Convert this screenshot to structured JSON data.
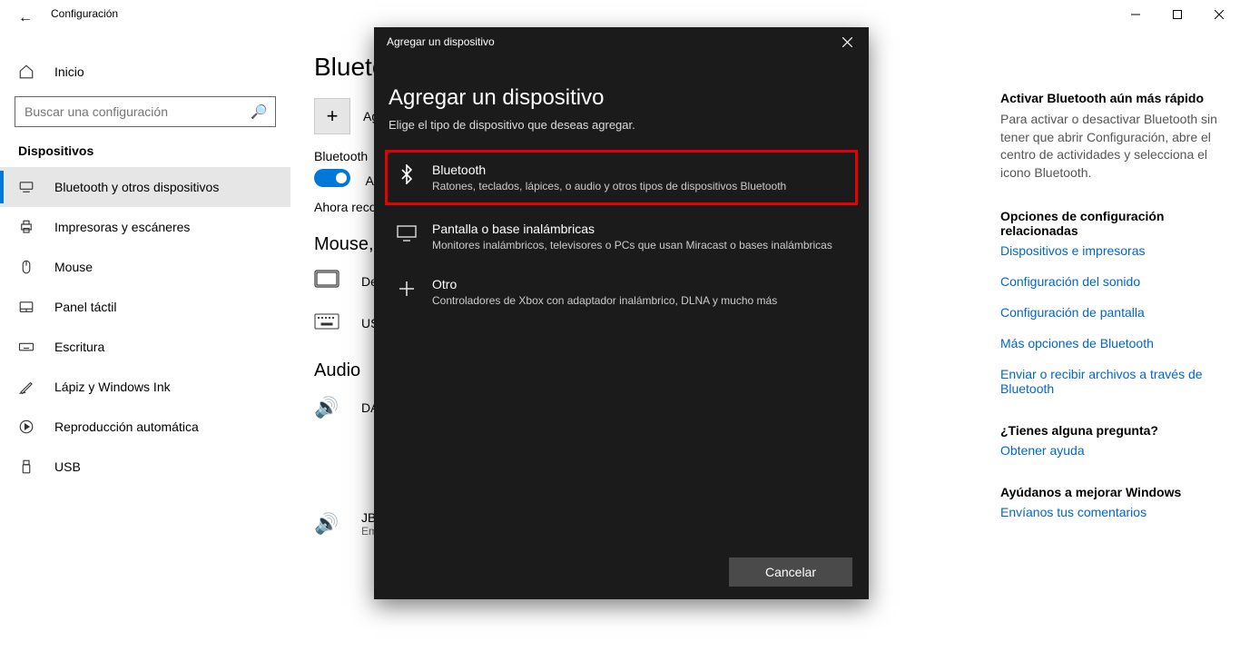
{
  "app_title": "Configuración",
  "titlebar": {
    "min": "—",
    "max": "❐",
    "close": "✕"
  },
  "back_icon": "←",
  "sidebar": {
    "home_label": "Inicio",
    "search_placeholder": "Buscar una configuración",
    "group_label": "Dispositivos",
    "items": [
      {
        "icon": "bt",
        "label": "Bluetooth y otros dispositivos",
        "selected": true
      },
      {
        "icon": "printer",
        "label": "Impresoras y escáneres"
      },
      {
        "icon": "mouse",
        "label": "Mouse"
      },
      {
        "icon": "touchpad",
        "label": "Panel táctil"
      },
      {
        "icon": "pen",
        "label": "Escritura"
      },
      {
        "icon": "ink",
        "label": "Lápiz y Windows Ink"
      },
      {
        "icon": "autoplay",
        "label": "Reproducción automática"
      },
      {
        "icon": "usb",
        "label": "USB"
      }
    ]
  },
  "main": {
    "page_title": "Bluetooth y otros dispositivos",
    "add_label": "Agregar Bluetooth u otro dispositivo",
    "bt_label": "Bluetooth",
    "toggle_state": "Activado",
    "discover_prefix": "Ahora reconocible como",
    "section_mouse": "Mouse, teclado y lápiz",
    "dev_dell": "De",
    "dev_usb": "USB",
    "section_audio": "Audio",
    "dev_da": "DA",
    "dev_jbl_name": "JBL Xtreme",
    "dev_jbl_status": "Emparejado"
  },
  "right": {
    "fast_h": "Activar Bluetooth aún más rápido",
    "fast_p": "Para activar o desactivar Bluetooth sin tener que abrir Configuración, abre el centro de actividades y selecciona el icono Bluetooth.",
    "related_h": "Opciones de configuración relacionadas",
    "links": [
      "Dispositivos e impresoras",
      "Configuración del sonido",
      "Configuración de pantalla",
      "Más opciones de Bluetooth",
      "Enviar o recibir archivos a través de Bluetooth"
    ],
    "question_h": "¿Tienes alguna pregunta?",
    "help_link": "Obtener ayuda",
    "improve_h": "Ayúdanos a mejorar Windows",
    "feedback_link": "Envíanos tus comentarios"
  },
  "modal": {
    "header": "Agregar un dispositivo",
    "title": "Agregar un dispositivo",
    "subtitle": "Elige el tipo de dispositivo que deseas agregar.",
    "options": [
      {
        "title": "Bluetooth",
        "desc": "Ratones, teclados, lápices, o audio y otros tipos de dispositivos Bluetooth",
        "highlight": true
      },
      {
        "title": "Pantalla o base inalámbricas",
        "desc": "Monitores inalámbricos, televisores o PCs que usan Miracast o bases inalámbricas"
      },
      {
        "title": "Otro",
        "desc": "Controladores de Xbox con adaptador inalámbrico, DLNA y mucho más"
      }
    ],
    "cancel": "Cancelar"
  }
}
